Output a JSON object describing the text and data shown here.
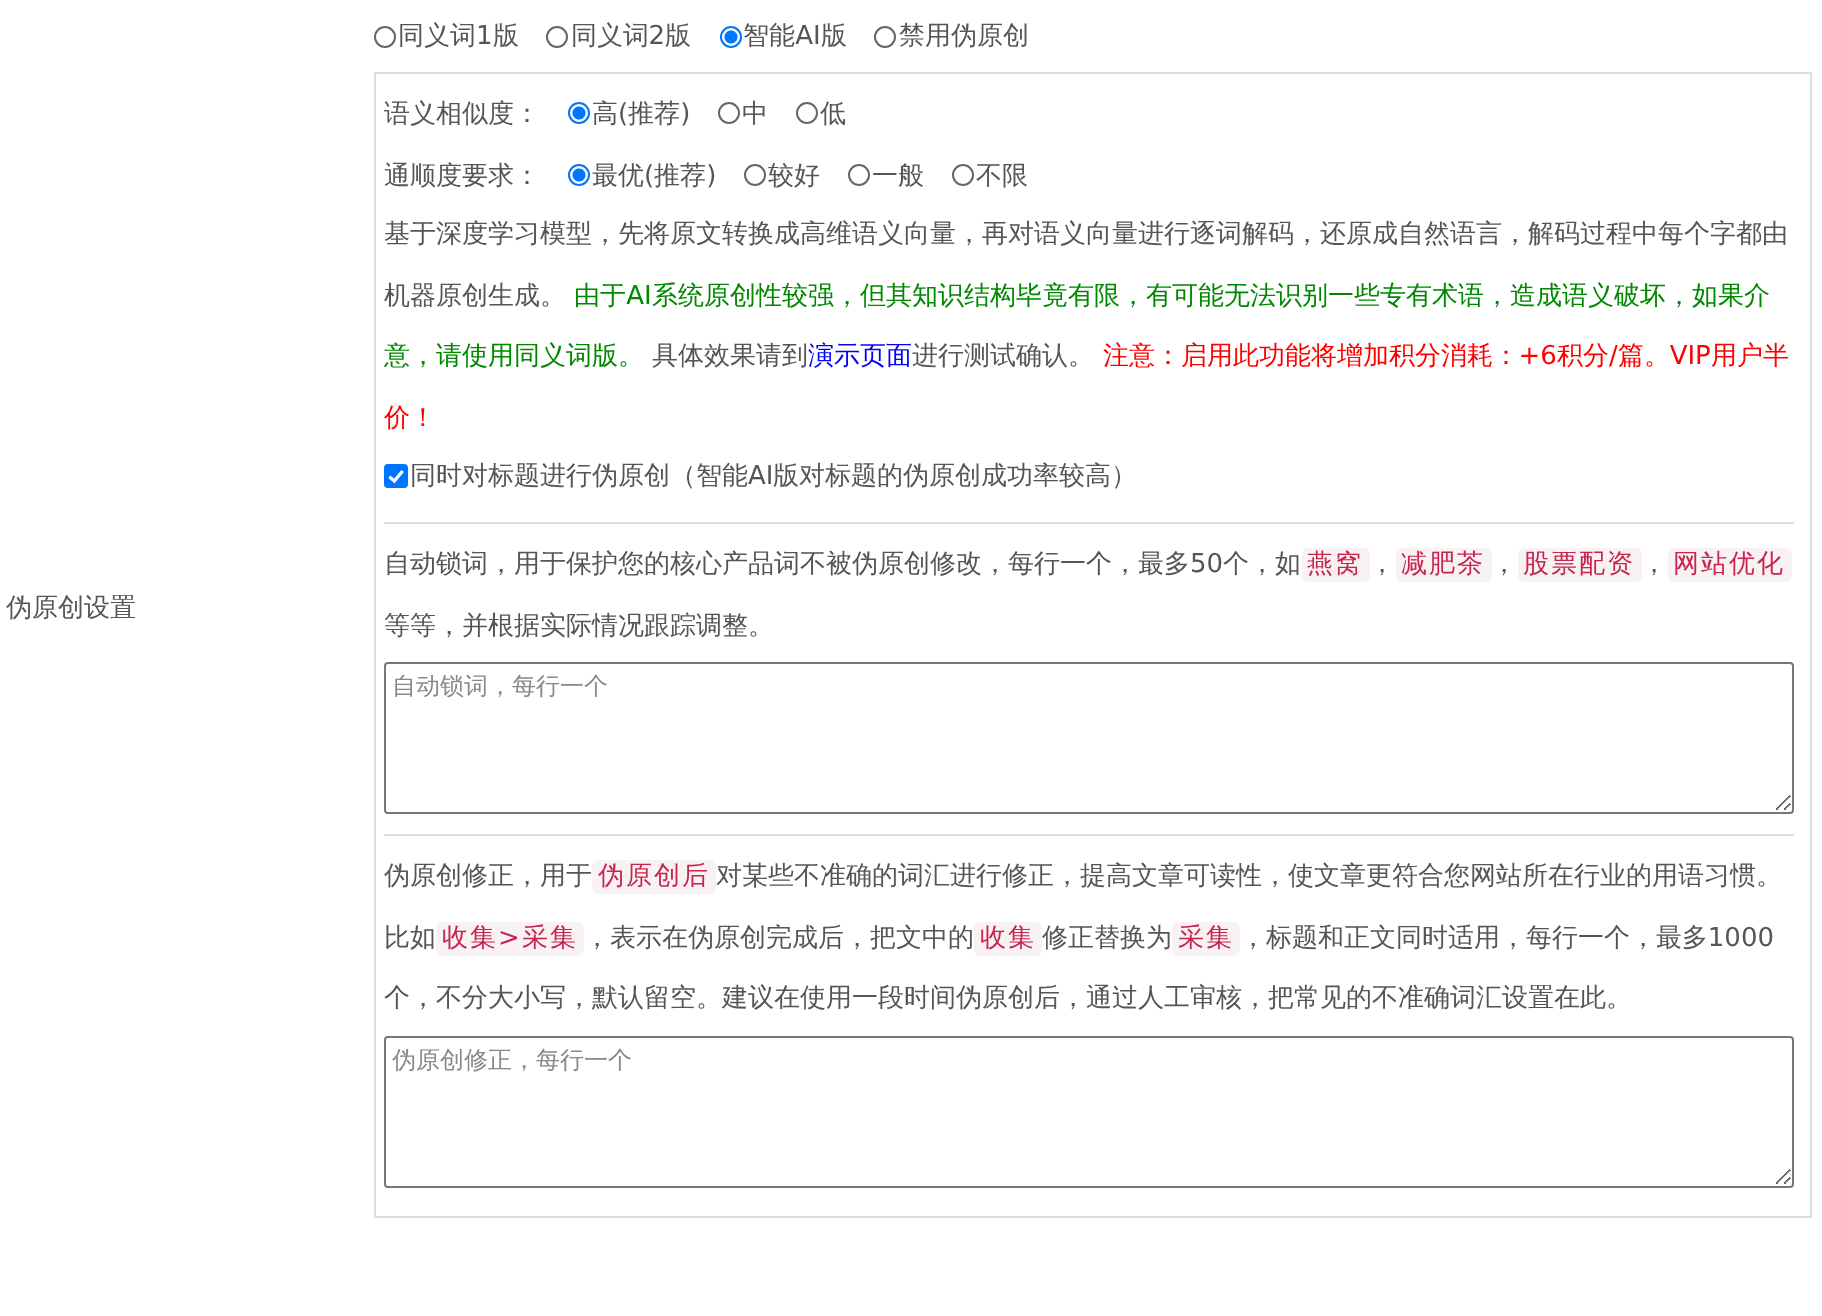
{
  "section_label": "伪原创设置",
  "modes": [
    {
      "label": "同义词1版",
      "selected": false
    },
    {
      "label": "同义词2版",
      "selected": false
    },
    {
      "label": "智能AI版",
      "selected": true
    },
    {
      "label": "禁用伪原创",
      "selected": false
    }
  ],
  "option_groups": [
    {
      "label": "语义相似度：",
      "options": [
        {
          "label": "高(推荐)",
          "selected": true
        },
        {
          "label": "中",
          "selected": false
        },
        {
          "label": "低",
          "selected": false
        }
      ]
    },
    {
      "label": "通顺度要求：",
      "options": [
        {
          "label": "最优(推荐)",
          "selected": true
        },
        {
          "label": "较好",
          "selected": false
        },
        {
          "label": "一般",
          "selected": false
        },
        {
          "label": "不限",
          "selected": false
        }
      ]
    }
  ],
  "description": [
    {
      "kind": "text",
      "text": "基于深度学习模型，先将原文转换成高维语义向量，再对语义向量进行逐词解码，还原成自然语言，解码过程中每个字都由机器原创生成。 "
    },
    {
      "kind": "notice",
      "text": "由于AI系统原创性较强，但其知识结构毕竟有限，有可能无法识别一些专有术语，造成语义破坏，如果介意，请使用同义词版。"
    },
    {
      "kind": "text",
      "text": " 具体效果请到"
    },
    {
      "kind": "link",
      "text": "演示页面"
    },
    {
      "kind": "text",
      "text": "进行测试确认。 "
    },
    {
      "kind": "warning",
      "text": "注意：启用此功能将增加积分消耗：+6积分/篇。VIP用户半价！"
    }
  ],
  "title_option": {
    "label": "同时对标题进行伪原创（智能AI版对标题的伪原创成功率较高）",
    "checked": true
  },
  "lock_words": {
    "description": [
      {
        "kind": "text",
        "text": "自动锁词，用于保护您的核心产品词不被伪原创修改，每行一个，最多50个，如"
      },
      {
        "kind": "tag",
        "text": "燕窝"
      },
      {
        "kind": "text",
        "text": "，"
      },
      {
        "kind": "tag",
        "text": "减肥茶"
      },
      {
        "kind": "text",
        "text": "，"
      },
      {
        "kind": "tag",
        "text": "股票配资"
      },
      {
        "kind": "text",
        "text": "，"
      },
      {
        "kind": "tag",
        "text": "网站优化"
      },
      {
        "kind": "text",
        "text": " 等等，并根据实际情况跟踪调整。"
      }
    ],
    "placeholder": "自动锁词，每行一个"
  },
  "corrections": {
    "description": [
      {
        "kind": "text",
        "text": "伪原创修正，用于"
      },
      {
        "kind": "tag",
        "text": "伪原创后"
      },
      {
        "kind": "text",
        "text": "对某些不准确的词汇进行修正，提高文章可读性，使文章更符合您网站所在行业的用语习惯。比如"
      },
      {
        "kind": "tag",
        "text": "收集>采集"
      },
      {
        "kind": "text",
        "text": "，表示在伪原创完成后，把文中的"
      },
      {
        "kind": "tag",
        "text": "收集"
      },
      {
        "kind": "text",
        "text": "修正替换为"
      },
      {
        "kind": "tag",
        "text": "采集"
      },
      {
        "kind": "text",
        "text": "，标题和正文同时适用，每行一个，最多1000个，不分大小写，默认留空。建议在使用一段时间伪原创后，通过人工审核，把常见的不准确词汇设置在此。"
      }
    ],
    "placeholder": "伪原创修正，每行一个"
  }
}
